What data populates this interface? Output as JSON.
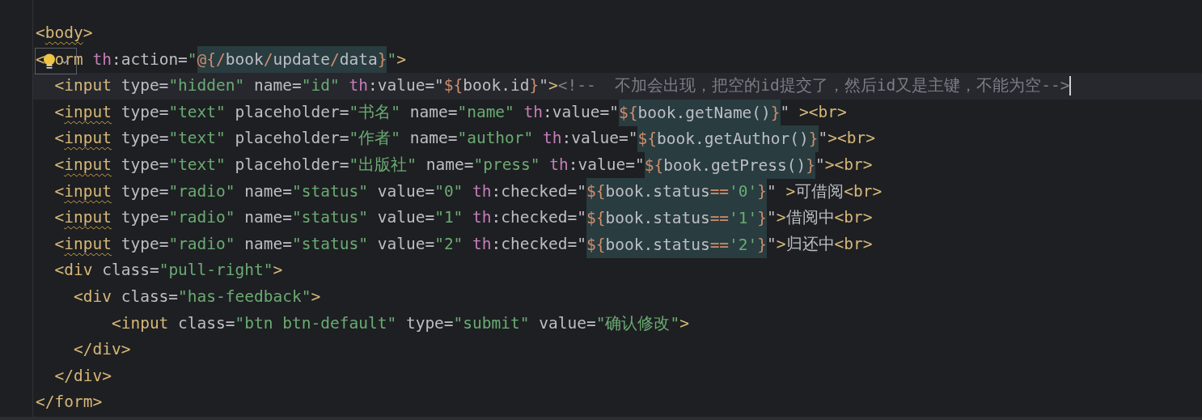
{
  "editor": {
    "lines": [
      {
        "current": false,
        "tokens": [
          {
            "kind": "tag",
            "text": "<"
          },
          {
            "kind": "warned-tag",
            "text": "body"
          },
          {
            "kind": "tag",
            "text": ">"
          }
        ]
      },
      {
        "current": false,
        "tokens": [
          {
            "kind": "tag",
            "text": "<"
          },
          {
            "kind": "covered"
          },
          {
            "kind": "tag",
            "text": "orm "
          },
          {
            "kind": "ns",
            "text": "th"
          },
          {
            "kind": "attr",
            "text": ":action="
          },
          {
            "kind": "str",
            "text": "\""
          },
          {
            "kind": "expression",
            "parts": [
              {
                "kind": "brace",
                "text": "@{"
              },
              {
                "kind": "brace",
                "text": "/"
              },
              {
                "kind": "expr",
                "text": "book"
              },
              {
                "kind": "brace",
                "text": "/"
              },
              {
                "kind": "expr",
                "text": "update"
              },
              {
                "kind": "brace",
                "text": "/"
              },
              {
                "kind": "expr",
                "text": "data"
              },
              {
                "kind": "brace",
                "text": "}"
              }
            ]
          },
          {
            "kind": "str",
            "text": "\""
          },
          {
            "kind": "tag",
            "text": ">"
          }
        ]
      },
      {
        "current": true,
        "tokens": [
          {
            "kind": "tag",
            "text": "  <input"
          },
          {
            "kind": "attr",
            "text": " type="
          },
          {
            "kind": "str",
            "text": "\"hidden\""
          },
          {
            "kind": "attr",
            "text": " name="
          },
          {
            "kind": "str",
            "text": "\"id\" "
          },
          {
            "kind": "ns",
            "text": "th"
          },
          {
            "kind": "attr",
            "text": ":value=\""
          },
          {
            "kind": "brace",
            "text": "${"
          },
          {
            "kind": "expr",
            "text": "book.id"
          },
          {
            "kind": "brace",
            "text": "}"
          },
          {
            "kind": "attr",
            "text": "\""
          },
          {
            "kind": "tag",
            "text": ">"
          },
          {
            "kind": "comment",
            "text": "<!--  不加会出现，把空的id提交了，然后id又是主键，不能为空-->"
          }
        ]
      },
      {
        "current": false,
        "tokens": [
          {
            "kind": "tag",
            "text": "  <"
          },
          {
            "kind": "warned-tag",
            "text": "input"
          },
          {
            "kind": "attr",
            "text": " type="
          },
          {
            "kind": "str",
            "text": "\"text\""
          },
          {
            "kind": "attr",
            "text": " placeholder="
          },
          {
            "kind": "str",
            "text": "\"书名\""
          },
          {
            "kind": "attr",
            "text": " name="
          },
          {
            "kind": "str",
            "text": "\"name\" "
          },
          {
            "kind": "ns",
            "text": "th"
          },
          {
            "kind": "attr",
            "text": ":value=\""
          },
          {
            "kind": "expression",
            "parts": [
              {
                "kind": "brace",
                "text": "${"
              },
              {
                "kind": "expr",
                "text": "book.getName()"
              },
              {
                "kind": "brace",
                "text": "}"
              }
            ]
          },
          {
            "kind": "attr",
            "text": "\" "
          },
          {
            "kind": "tag",
            "text": "><br>"
          }
        ]
      },
      {
        "current": false,
        "tokens": [
          {
            "kind": "tag",
            "text": "  <"
          },
          {
            "kind": "warned-tag",
            "text": "input"
          },
          {
            "kind": "attr",
            "text": " type="
          },
          {
            "kind": "str",
            "text": "\"text\""
          },
          {
            "kind": "attr",
            "text": " placeholder="
          },
          {
            "kind": "str",
            "text": "\"作者\""
          },
          {
            "kind": "attr",
            "text": " name="
          },
          {
            "kind": "str",
            "text": "\"author\" "
          },
          {
            "kind": "ns",
            "text": "th"
          },
          {
            "kind": "attr",
            "text": ":value=\""
          },
          {
            "kind": "expression",
            "parts": [
              {
                "kind": "brace",
                "text": "${"
              },
              {
                "kind": "expr",
                "text": "book.getAuthor()"
              },
              {
                "kind": "brace",
                "text": "}"
              }
            ]
          },
          {
            "kind": "attr",
            "text": "\""
          },
          {
            "kind": "tag",
            "text": "><br>"
          }
        ]
      },
      {
        "current": false,
        "tokens": [
          {
            "kind": "tag",
            "text": "  <"
          },
          {
            "kind": "warned-tag",
            "text": "input"
          },
          {
            "kind": "attr",
            "text": " type="
          },
          {
            "kind": "str",
            "text": "\"text\""
          },
          {
            "kind": "attr",
            "text": " placeholder="
          },
          {
            "kind": "str",
            "text": "\"出版社\""
          },
          {
            "kind": "attr",
            "text": " name="
          },
          {
            "kind": "str",
            "text": "\"press\" "
          },
          {
            "kind": "ns",
            "text": "th"
          },
          {
            "kind": "attr",
            "text": ":value=\""
          },
          {
            "kind": "expression",
            "parts": [
              {
                "kind": "brace",
                "text": "${"
              },
              {
                "kind": "expr",
                "text": "book.getPress()"
              },
              {
                "kind": "brace",
                "text": "}"
              }
            ]
          },
          {
            "kind": "attr",
            "text": "\""
          },
          {
            "kind": "tag",
            "text": "><br>"
          }
        ]
      },
      {
        "current": false,
        "tokens": [
          {
            "kind": "tag",
            "text": "  <"
          },
          {
            "kind": "warned-tag",
            "text": "input"
          },
          {
            "kind": "attr",
            "text": " type="
          },
          {
            "kind": "str",
            "text": "\"radio\""
          },
          {
            "kind": "attr",
            "text": " name="
          },
          {
            "kind": "str",
            "text": "\"status\""
          },
          {
            "kind": "attr",
            "text": " value="
          },
          {
            "kind": "str",
            "text": "\"0\" "
          },
          {
            "kind": "ns",
            "text": "th"
          },
          {
            "kind": "attr",
            "text": ":checked=\""
          },
          {
            "kind": "expression",
            "parts": [
              {
                "kind": "brace",
                "text": "${"
              },
              {
                "kind": "expr",
                "text": "book.status"
              },
              {
                "kind": "brace",
                "text": "=="
              },
              {
                "kind": "str",
                "text": "'0'"
              },
              {
                "kind": "brace",
                "text": "}"
              }
            ]
          },
          {
            "kind": "attr",
            "text": "\" "
          },
          {
            "kind": "tag",
            "text": ">"
          },
          {
            "kind": "text",
            "text": "可借阅"
          },
          {
            "kind": "tag",
            "text": "<br>"
          }
        ]
      },
      {
        "current": false,
        "tokens": [
          {
            "kind": "tag",
            "text": "  <"
          },
          {
            "kind": "warned-tag",
            "text": "input"
          },
          {
            "kind": "attr",
            "text": " type="
          },
          {
            "kind": "str",
            "text": "\"radio\""
          },
          {
            "kind": "attr",
            "text": " name="
          },
          {
            "kind": "str",
            "text": "\"status\""
          },
          {
            "kind": "attr",
            "text": " value="
          },
          {
            "kind": "str",
            "text": "\"1\" "
          },
          {
            "kind": "ns",
            "text": "th"
          },
          {
            "kind": "attr",
            "text": ":checked=\""
          },
          {
            "kind": "expression",
            "parts": [
              {
                "kind": "brace",
                "text": "${"
              },
              {
                "kind": "expr",
                "text": "book.status"
              },
              {
                "kind": "brace",
                "text": "=="
              },
              {
                "kind": "str",
                "text": "'1'"
              },
              {
                "kind": "brace",
                "text": "}"
              }
            ]
          },
          {
            "kind": "attr",
            "text": "\""
          },
          {
            "kind": "tag",
            "text": ">"
          },
          {
            "kind": "text",
            "text": "借阅中"
          },
          {
            "kind": "tag",
            "text": "<br>"
          }
        ]
      },
      {
        "current": false,
        "tokens": [
          {
            "kind": "tag",
            "text": "  <"
          },
          {
            "kind": "warned-tag",
            "text": "input"
          },
          {
            "kind": "attr",
            "text": " type="
          },
          {
            "kind": "str",
            "text": "\"radio\""
          },
          {
            "kind": "attr",
            "text": " name="
          },
          {
            "kind": "str",
            "text": "\"status\""
          },
          {
            "kind": "attr",
            "text": " value="
          },
          {
            "kind": "str",
            "text": "\"2\" "
          },
          {
            "kind": "ns",
            "text": "th"
          },
          {
            "kind": "attr",
            "text": ":checked=\""
          },
          {
            "kind": "expression",
            "parts": [
              {
                "kind": "brace",
                "text": "${"
              },
              {
                "kind": "expr",
                "text": "book.status"
              },
              {
                "kind": "brace",
                "text": "=="
              },
              {
                "kind": "str",
                "text": "'2'"
              },
              {
                "kind": "brace",
                "text": "}"
              }
            ]
          },
          {
            "kind": "attr",
            "text": "\""
          },
          {
            "kind": "tag",
            "text": ">"
          },
          {
            "kind": "text",
            "text": "归还中"
          },
          {
            "kind": "tag",
            "text": "<br>"
          }
        ]
      },
      {
        "current": false,
        "tokens": [
          {
            "kind": "tag",
            "text": "  <div"
          },
          {
            "kind": "attr",
            "text": " class="
          },
          {
            "kind": "str",
            "text": "\"pull-right\""
          },
          {
            "kind": "tag",
            "text": ">"
          }
        ]
      },
      {
        "current": false,
        "tokens": [
          {
            "kind": "tag",
            "text": "    <div"
          },
          {
            "kind": "attr",
            "text": " class="
          },
          {
            "kind": "str",
            "text": "\"has-feedback\""
          },
          {
            "kind": "tag",
            "text": ">"
          }
        ]
      },
      {
        "current": false,
        "tokens": [
          {
            "kind": "tag",
            "text": "        <input"
          },
          {
            "kind": "attr",
            "text": " class="
          },
          {
            "kind": "str",
            "text": "\"btn btn-default\""
          },
          {
            "kind": "attr",
            "text": " type="
          },
          {
            "kind": "str",
            "text": "\"submit\""
          },
          {
            "kind": "attr",
            "text": " value="
          },
          {
            "kind": "str",
            "text": "\"确认修改\""
          },
          {
            "kind": "tag",
            "text": ">"
          }
        ]
      },
      {
        "current": false,
        "tokens": [
          {
            "kind": "tag",
            "text": "    </div>"
          }
        ]
      },
      {
        "current": false,
        "tokens": [
          {
            "kind": "tag",
            "text": "  </div>"
          }
        ]
      },
      {
        "current": false,
        "tokens": [
          {
            "kind": "tag",
            "text": "</form>"
          }
        ]
      }
    ]
  }
}
